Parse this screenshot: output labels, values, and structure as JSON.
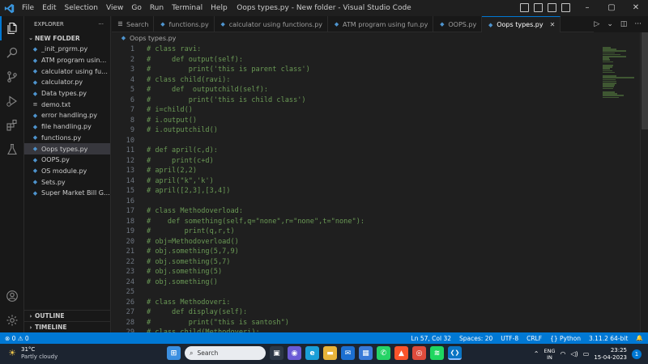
{
  "titlebar": {
    "logo": "vscode-logo",
    "menu": [
      "File",
      "Edit",
      "Selection",
      "View",
      "Go",
      "Run",
      "Terminal",
      "Help"
    ],
    "window_title": "Oops types.py - New folder - Visual Studio Code",
    "controls": [
      "–",
      "▢",
      "✕"
    ]
  },
  "activitybar": {
    "icons": [
      "files-icon",
      "search-icon",
      "source-control-icon",
      "run-debug-icon",
      "extensions-icon",
      "testing-icon",
      "account-icon",
      "settings-gear-icon"
    ]
  },
  "sidebar": {
    "title": "EXPLORER",
    "more": "···",
    "folder": "NEW FOLDER",
    "files": [
      {
        "name": "_init_prgrm.py",
        "type": "py"
      },
      {
        "name": "ATM program using f...",
        "type": "py"
      },
      {
        "name": "calculator using functi...",
        "type": "py"
      },
      {
        "name": "calculator.py",
        "type": "py"
      },
      {
        "name": "Data types.py",
        "type": "py"
      },
      {
        "name": "demo.txt",
        "type": "txt"
      },
      {
        "name": "error handling.py",
        "type": "py"
      },
      {
        "name": "file handling.py",
        "type": "py"
      },
      {
        "name": "functions.py",
        "type": "py"
      },
      {
        "name": "Oops types.py",
        "type": "py"
      },
      {
        "name": "OOPS.py",
        "type": "py"
      },
      {
        "name": "OS module.py",
        "type": "py"
      },
      {
        "name": "Sets.py",
        "type": "py"
      },
      {
        "name": "Super Market Bill Gen...",
        "type": "py"
      }
    ],
    "selected_file": "Oops types.py",
    "outline": "OUTLINE",
    "timeline": "TIMELINE"
  },
  "tabs": [
    {
      "label": "Search",
      "type": "search"
    },
    {
      "label": "functions.py",
      "type": "py"
    },
    {
      "label": "calculator using functions.py",
      "type": "py"
    },
    {
      "label": "ATM program using fun.py",
      "type": "py"
    },
    {
      "label": "OOPS.py",
      "type": "py"
    },
    {
      "label": "Oops types.py",
      "type": "py",
      "active": true
    }
  ],
  "tab_actions": [
    "▷",
    "⌄",
    "◫",
    "···"
  ],
  "breadcrumb": "Oops types.py",
  "editor": {
    "lines": [
      "# class ravi:",
      "#     def output(self):",
      "#         print('this is parent class')",
      "# class child(ravi):",
      "#     def  outputchild(self):",
      "#         print('this is child class')",
      "# i=child()",
      "# i.output()",
      "# i.outputchild()",
      "",
      "# def april(c,d):",
      "#     print(c+d)",
      "# april(2,2)",
      "# april(\"k\",'k')",
      "# april([2,3],[3,4])",
      "",
      "# class Methodoverload:",
      "#    def something(self,q=\"none\",r=\"none\",t=\"none\"):",
      "#        print(q,r,t)",
      "# obj=Methodoverload()",
      "# obj.something(5,7,9)",
      "# obj.something(5,7)",
      "# obj.something(5)",
      "# obj.something()",
      "",
      "# class Methodoveri:",
      "#     def display(self):",
      "#         print(\"this is santosh\")",
      "# class child(Methodoveri):"
    ]
  },
  "statusbar": {
    "problems": "⊗ 0 ⚠ 0",
    "position": "Ln 57, Col 32",
    "spaces": "Spaces: 20",
    "encoding": "UTF-8",
    "eol": "CRLF",
    "language": "{} Python",
    "interpreter": "3.11.2 64-bit",
    "bell": "🔔"
  },
  "taskbar": {
    "weather_temp": "31°C",
    "weather_desc": "Partly cloudy",
    "search_placeholder": "Search",
    "apps": [
      {
        "name": "windows-start-icon",
        "color": "#3b8fe0",
        "glyph": "⊞"
      },
      {
        "name": "taskview-icon",
        "color": "#2d3846",
        "glyph": "▣"
      },
      {
        "name": "chat-icon",
        "color": "#6b5bd6",
        "glyph": "◉"
      },
      {
        "name": "edge-icon",
        "color": "#1a9fd8",
        "glyph": "e"
      },
      {
        "name": "file-explorer-icon",
        "color": "#e8b43a",
        "glyph": "▬"
      },
      {
        "name": "mail-icon",
        "color": "#1c6fd1",
        "glyph": "✉"
      },
      {
        "name": "store-icon",
        "color": "#3a7ad8",
        "glyph": "▦"
      },
      {
        "name": "whatsapp-icon",
        "color": "#25d366",
        "glyph": "✆"
      },
      {
        "name": "brave-icon",
        "color": "#fb542b",
        "glyph": "▲"
      },
      {
        "name": "chrome-icon",
        "color": "#de4b3c",
        "glyph": "◎"
      },
      {
        "name": "spotify-icon",
        "color": "#1ed760",
        "glyph": "≋"
      },
      {
        "name": "vscode-icon",
        "color": "#0a74c4",
        "glyph": "❮❯"
      }
    ],
    "lang_top": "ENG",
    "lang_bottom": "IN",
    "time": "23:25",
    "date": "15-04-2023",
    "notifications": "1"
  }
}
